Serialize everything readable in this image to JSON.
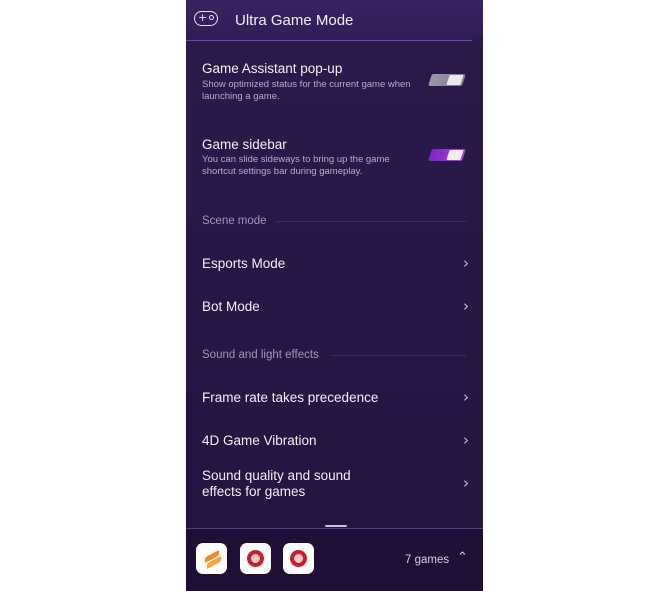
{
  "header": {
    "title": "Ultra Game Mode",
    "icon": "gamepad-icon"
  },
  "toggles": [
    {
      "title": "Game Assistant pop-up",
      "description": "Show optimized status for the current game when launching a game.",
      "state": "off"
    },
    {
      "title": "Game sidebar",
      "description": "You can slide sideways to bring up the game shortcut settings bar during gameplay.",
      "state": "on"
    }
  ],
  "sections": {
    "scene": "Scene mode",
    "sound_light": "Sound and light effects"
  },
  "scene_items": [
    "Esports Mode",
    "Bot Mode"
  ],
  "effect_items": [
    "Frame rate takes precedence",
    "4D Game Vibration",
    "Sound quality and sound effects for games"
  ],
  "bottom": {
    "games_count": "7 games",
    "apps": [
      "swift-app-icon",
      "game-app-icon",
      "game-app-icon"
    ]
  },
  "colors": {
    "background": "#281646",
    "accent_on": "#b13fe0",
    "text": "#f3f0f9"
  }
}
